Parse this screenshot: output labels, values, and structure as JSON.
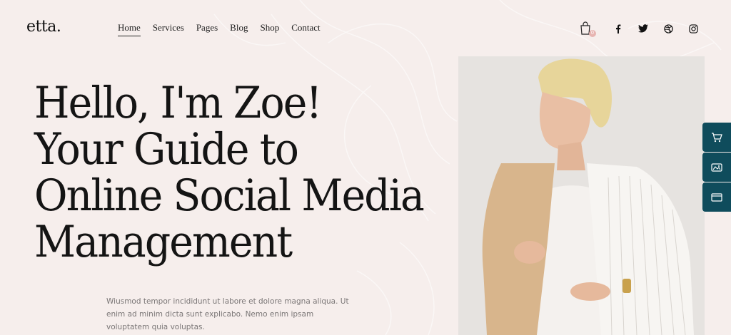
{
  "brand": {
    "logo": "etta."
  },
  "nav": {
    "items": [
      {
        "label": "Home",
        "active": true
      },
      {
        "label": "Services"
      },
      {
        "label": "Pages"
      },
      {
        "label": "Blog"
      },
      {
        "label": "Shop"
      },
      {
        "label": "Contact"
      }
    ]
  },
  "cart": {
    "count": "0",
    "icon": "shopping-bag-icon"
  },
  "social": [
    "facebook-icon",
    "twitter-icon",
    "dribbble-icon",
    "instagram-icon"
  ],
  "hero": {
    "lines": [
      "Hello, I'm Zoe!",
      "Your Guide to",
      "Online Social Media",
      "Management"
    ],
    "intro": "Wiusmod tempor incididunt ut labore et dolore magna aliqua. Ut enim ad minim dicta sunt explicabo. Nemo enim ipsam voluptatem quia voluptas."
  },
  "side_widget": [
    "cart-icon",
    "gallery-icon",
    "window-icon"
  ],
  "colors": {
    "background": "#f6eeec",
    "accent": "#0f4c5c",
    "badge": "#e7b4b1"
  }
}
